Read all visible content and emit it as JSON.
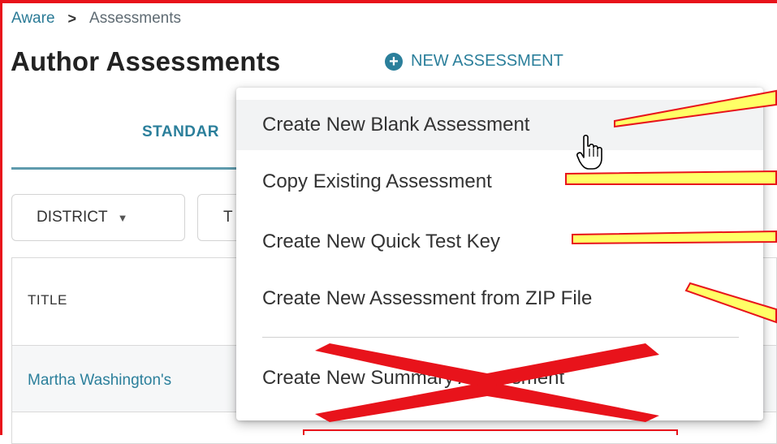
{
  "breadcrumb": {
    "root": "Aware",
    "separator": ">",
    "current": "Assessments"
  },
  "header": {
    "title": "Author Assessments",
    "new_button_label": "NEW ASSESSMENT",
    "new_button_icon": "plus-circle-icon"
  },
  "tabs": {
    "standard_label": "STANDAR"
  },
  "filters": {
    "district_label": "DISTRICT",
    "district_icon": "caret-down-icon",
    "second_label_partial": "T"
  },
  "table": {
    "column_title": "TITLE",
    "rows": [
      {
        "title": "Martha Washington's"
      }
    ]
  },
  "menu": {
    "items": [
      {
        "label": "Create New Blank Assessment"
      },
      {
        "label": "Copy Existing Assessment"
      },
      {
        "label": "Create New Quick Test Key"
      },
      {
        "label": "Create New Assessment from ZIP File"
      },
      {
        "label": "Create New Summary Assessment"
      }
    ]
  },
  "colors": {
    "accent": "#2b7f9b",
    "annotation_red": "#e8131b",
    "annotation_yellow": "#ffff66"
  }
}
